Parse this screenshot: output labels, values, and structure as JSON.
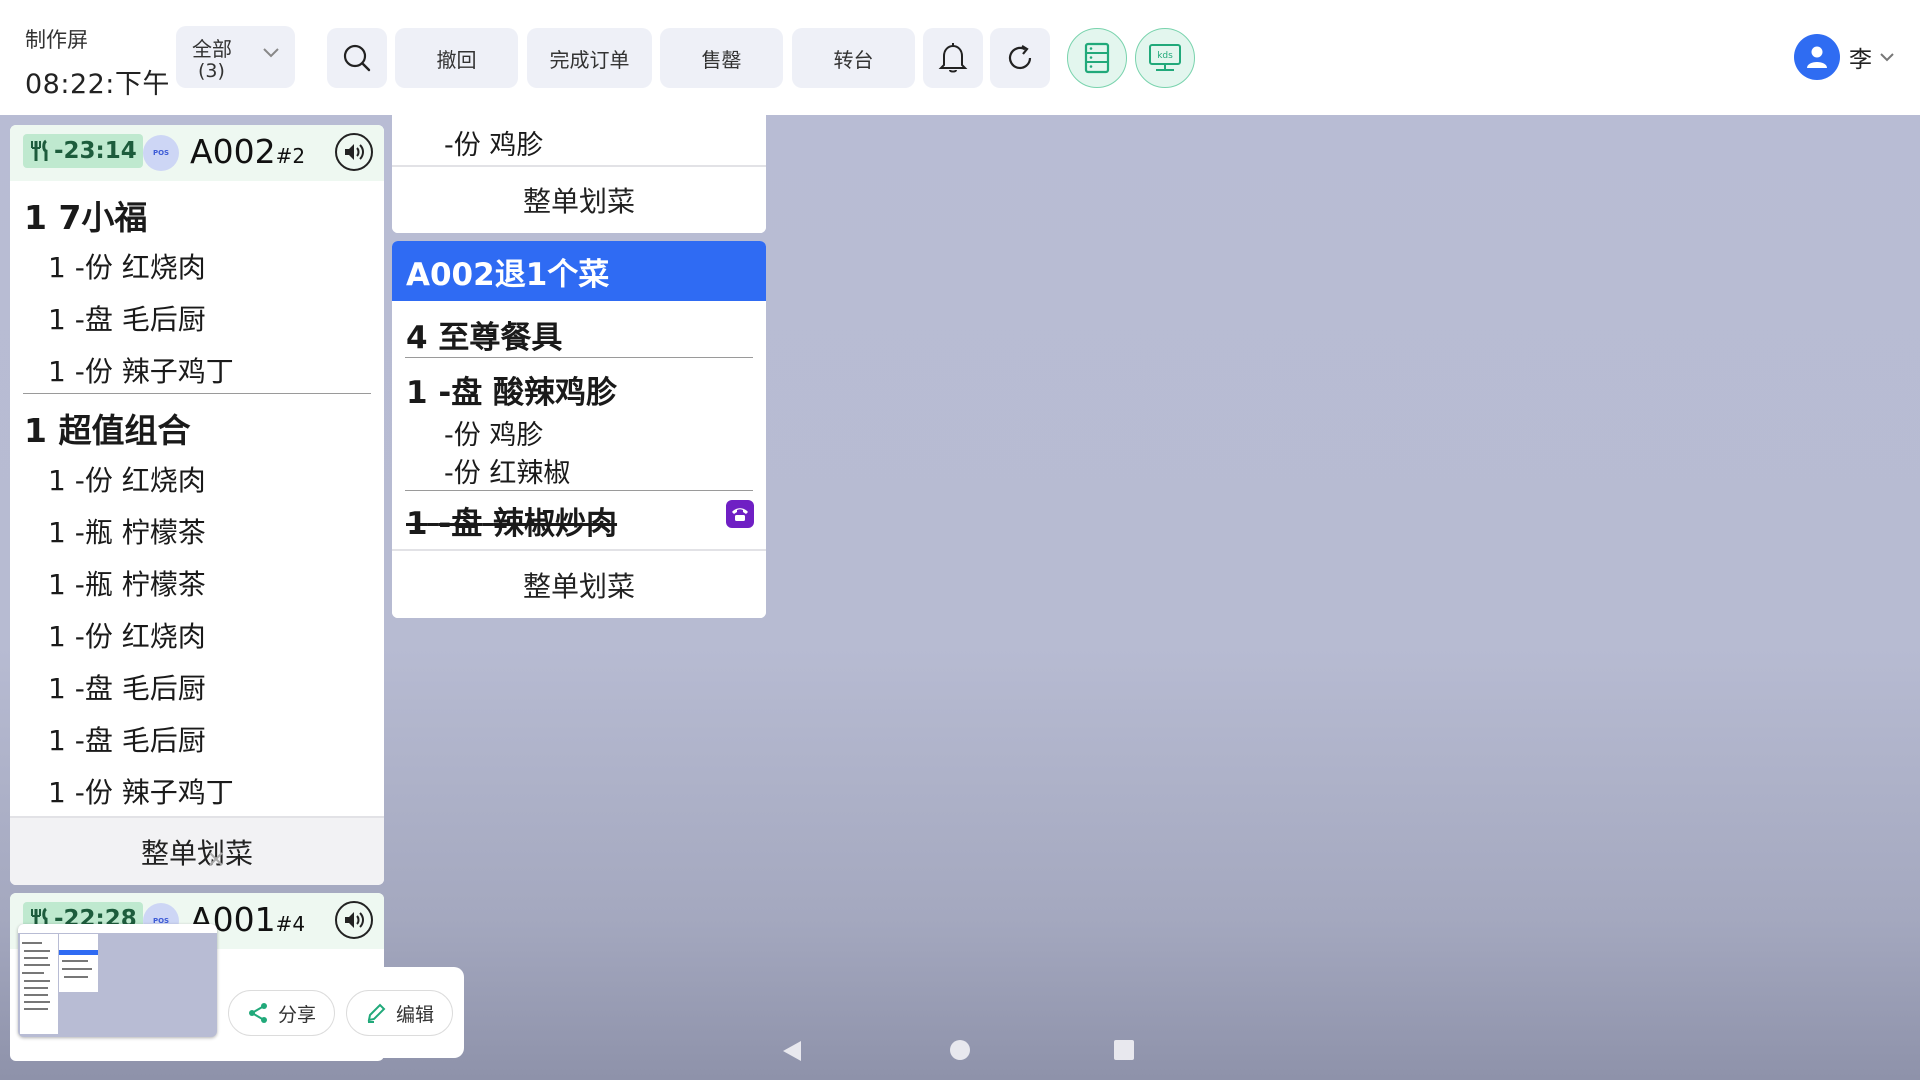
{
  "header": {
    "screen_name": "制作屏",
    "time": "08:22:下午",
    "filter": {
      "label": "全部",
      "count": "(3)"
    },
    "buttons": {
      "undo": "撤回",
      "complete_order": "完成订单",
      "sold_out": "售罄",
      "transfer_table": "转台"
    },
    "kds_label": "kds",
    "user_name": "李"
  },
  "tickets": {
    "a002": {
      "timer": "-23:14",
      "pos_label": "POS",
      "number": "A002",
      "seq": "#2",
      "groups": [
        {
          "qty": "1",
          "name": "7小福",
          "items": [
            {
              "qty": "1",
              "unit": "-份",
              "name": "红烧肉"
            },
            {
              "qty": "1",
              "unit": "-盘",
              "name": "毛后厨"
            },
            {
              "qty": "1",
              "unit": "-份",
              "name": "辣子鸡丁"
            }
          ]
        },
        {
          "qty": "1",
          "name": "超值组合",
          "items": [
            {
              "qty": "1",
              "unit": "-份",
              "name": "红烧肉"
            },
            {
              "qty": "1",
              "unit": "-瓶",
              "name": "柠檬茶"
            },
            {
              "qty": "1",
              "unit": "-瓶",
              "name": "柠檬茶"
            },
            {
              "qty": "1",
              "unit": "-份",
              "name": "红烧肉"
            },
            {
              "qty": "1",
              "unit": "-盘",
              "name": "毛后厨"
            },
            {
              "qty": "1",
              "unit": "-盘",
              "name": "毛后厨"
            },
            {
              "qty": "1",
              "unit": "-份",
              "name": "辣子鸡丁"
            }
          ]
        }
      ],
      "footer": "整单划菜"
    },
    "a001": {
      "timer": "-22:28",
      "pos_label": "POS",
      "number": "A001",
      "seq": "#4"
    },
    "top_partial": {
      "mod_line": "-份 鸡胗",
      "footer": "整单划菜"
    },
    "refund": {
      "banner": "A002退1个菜",
      "items": [
        {
          "qty": "4",
          "name": "至尊餐具"
        },
        {
          "qty": "1",
          "unit": "-盘",
          "name": "酸辣鸡胗",
          "mods": [
            "-份 鸡胗",
            "-份 红辣椒"
          ]
        },
        {
          "qty": "1",
          "unit": "-盘",
          "name": "辣椒炒肉"
        }
      ],
      "footer": "整单划菜"
    }
  },
  "screenshot_overlay": {
    "share": "分享",
    "edit": "编辑"
  },
  "colors": {
    "accent_blue": "#2f6bf3",
    "timer_green": "#bfe9cf",
    "kds_green": "#79d3ad",
    "phone_purple": "#6f1fc4",
    "background": "#b8bcd4"
  }
}
